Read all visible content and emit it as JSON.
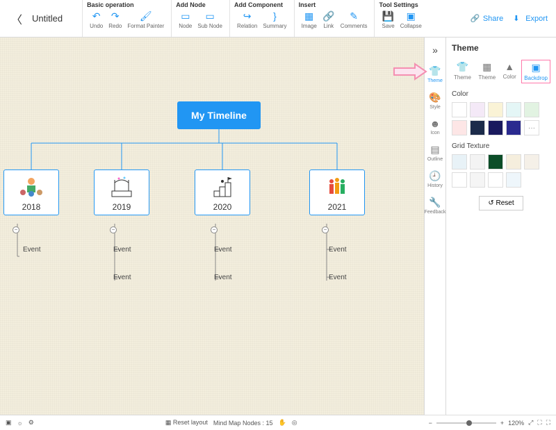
{
  "doc": {
    "title": "Untitled"
  },
  "toolbar": {
    "groups": [
      {
        "title": "Basic operation",
        "items": [
          {
            "id": "undo",
            "label": "Undo",
            "glyph": "↶"
          },
          {
            "id": "redo",
            "label": "Redo",
            "glyph": "↷"
          },
          {
            "id": "format-painter",
            "label": "Format Painter",
            "glyph": "🖌"
          }
        ]
      },
      {
        "title": "Add Node",
        "items": [
          {
            "id": "node",
            "label": "Node",
            "glyph": "▭"
          },
          {
            "id": "sub-node",
            "label": "Sub Node",
            "glyph": "▭"
          }
        ]
      },
      {
        "title": "Add Component",
        "items": [
          {
            "id": "relation",
            "label": "Relation",
            "glyph": "↪"
          },
          {
            "id": "summary",
            "label": "Summary",
            "glyph": "}"
          }
        ]
      },
      {
        "title": "Insert",
        "items": [
          {
            "id": "image",
            "label": "Image",
            "glyph": "▦"
          },
          {
            "id": "link",
            "label": "Link",
            "glyph": "🔗"
          },
          {
            "id": "comments",
            "label": "Comments",
            "glyph": "✎"
          }
        ]
      },
      {
        "title": "Tool Settings",
        "items": [
          {
            "id": "save",
            "label": "Save",
            "glyph": "💾"
          },
          {
            "id": "collapse",
            "label": "Collapse",
            "glyph": "▣"
          }
        ]
      }
    ],
    "share": "Share",
    "export": "Export"
  },
  "mindmap": {
    "root": "My Timeline",
    "years": [
      {
        "year": "2018",
        "events": [
          "Event"
        ]
      },
      {
        "year": "2019",
        "events": [
          "Event",
          "Event"
        ]
      },
      {
        "year": "2020",
        "events": [
          "Event",
          "Event"
        ]
      },
      {
        "year": "2021",
        "events": [
          "Event",
          "Event"
        ]
      }
    ]
  },
  "rail": {
    "items": [
      {
        "id": "theme",
        "label": "Theme",
        "glyph": "👕",
        "active": true
      },
      {
        "id": "style",
        "label": "Style",
        "glyph": "🎨"
      },
      {
        "id": "icon",
        "label": "Icon",
        "glyph": "☻"
      },
      {
        "id": "outline",
        "label": "Outline",
        "glyph": "▤"
      },
      {
        "id": "history",
        "label": "History",
        "glyph": "🕘"
      },
      {
        "id": "feedback",
        "label": "Feedback",
        "glyph": "🔧"
      }
    ]
  },
  "panel": {
    "title": "Theme",
    "tabs": [
      {
        "id": "theme",
        "label": "Theme",
        "glyph": "👕"
      },
      {
        "id": "theme2",
        "label": "Theme",
        "glyph": "▦"
      },
      {
        "id": "color",
        "label": "Color",
        "glyph": "▲"
      },
      {
        "id": "backdrop",
        "label": "Backdrop",
        "glyph": "▣",
        "active": true,
        "highlight": true
      }
    ],
    "color_label": "Color",
    "colors": [
      "#ffffff",
      "#f4e9f7",
      "#faf3d6",
      "#e4f6f6",
      "#e2f3e2",
      "#fde6e6",
      "#1c2b4a",
      "#1a1a5e",
      "#2a2a8f",
      "#ffffff_more"
    ],
    "grid_label": "Grid Texture",
    "grids": [
      "#e8f2f7",
      "#f3f3f3",
      "#0c4d28",
      "#f5eedd",
      "#f5f0e8",
      "#fff",
      "#f5f5f5",
      "#ffffff",
      "#eef6fb"
    ],
    "reset": "Reset"
  },
  "status": {
    "reset_layout": "Reset layout",
    "nodes_label": "Mind Map Nodes :",
    "nodes_count": "15",
    "zoom": "120%"
  }
}
